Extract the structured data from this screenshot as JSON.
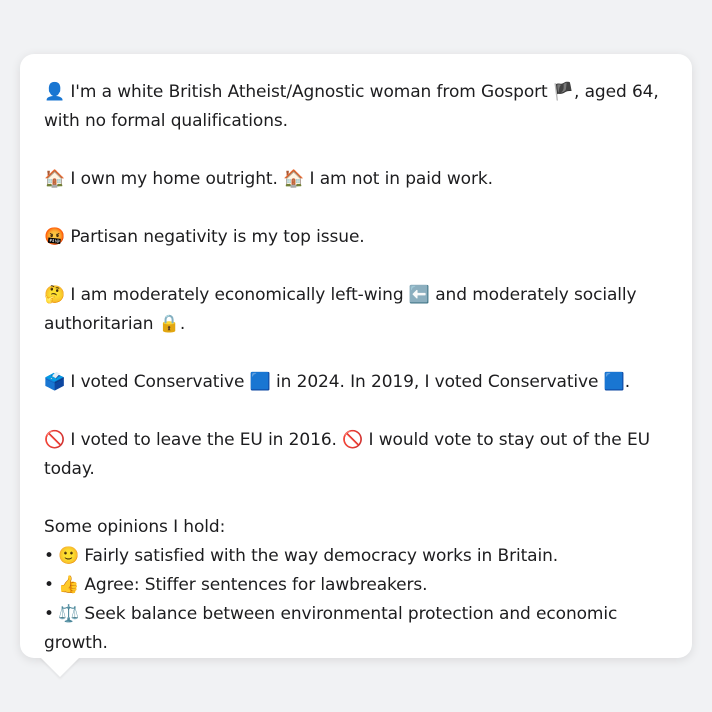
{
  "profile": {
    "intro": {
      "icon": "👤",
      "text_a": " I'm a white British Atheist/Agnostic woman from Gosport ",
      "flag": "🏴",
      "text_b": ", aged 64, with no formal qualifications."
    },
    "housing": {
      "icon1": "🏠",
      "text_a": " I own my home outright. ",
      "icon2": "🏠",
      "text_b": " I am not in paid work."
    },
    "issue": {
      "icon": "🤬",
      "text": " Partisan negativity is my top issue."
    },
    "ideology": {
      "icon": "🤔",
      "text_a": " I am moderately economically left-wing ",
      "arrow": "⬅️",
      "text_b": " and moderately socially authoritarian ",
      "lock": "🔒",
      "text_c": "."
    },
    "voting": {
      "icon": "🗳️",
      "text_a": " I voted Conservative ",
      "square1": "🟦",
      "text_b": " in 2024. In 2019, I voted Conservative ",
      "square2": "🟦",
      "text_c": "."
    },
    "eu": {
      "icon1": "🚫",
      "text_a": " I voted to leave the EU in 2016. ",
      "icon2": "🚫",
      "text_b": " I would vote to stay out of the EU today."
    },
    "opinions": {
      "heading": "Some opinions I hold:",
      "bullet": "•",
      "items": [
        {
          "icon": "🙂",
          "text": " Fairly satisfied with the way democracy works in Britain."
        },
        {
          "icon": "👍",
          "text": " Agree: Stiffer sentences for lawbreakers."
        },
        {
          "icon": "⚖️",
          "text": " Seek balance between environmental protection and economic growth."
        }
      ]
    }
  },
  "colors": {
    "background": "#f1f2f4",
    "card": "#ffffff",
    "text": "#1d1d1f"
  }
}
